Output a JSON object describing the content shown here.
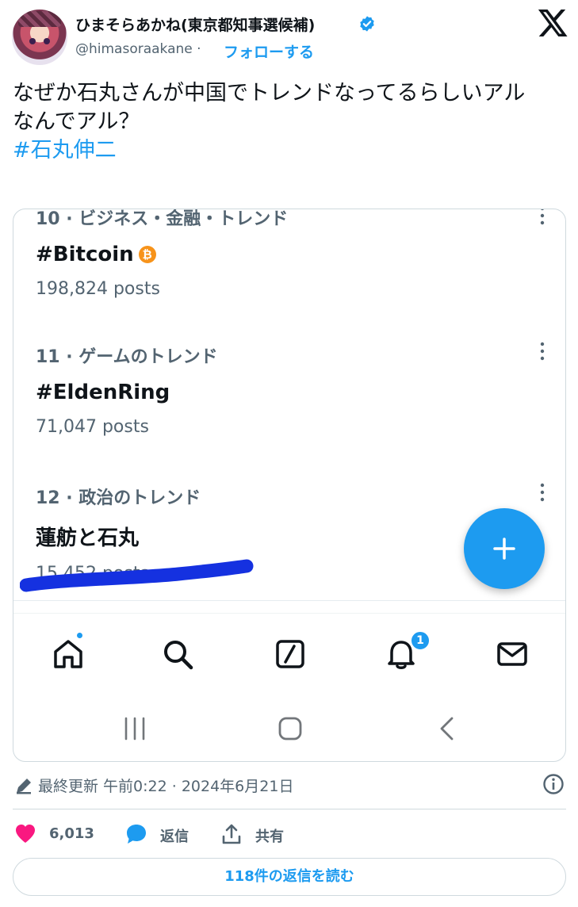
{
  "author": {
    "name": "ひまそらあかね(東京都知事選候補)",
    "handle": "@himasoraakane",
    "separator": "·",
    "follow_label": "フォローする"
  },
  "tweet": {
    "line1": "なぜか石丸さんが中国でトレンドなってるらしいアル",
    "line2": "なんでアル？",
    "hashtag": "#石丸伸二"
  },
  "screenshot": {
    "trends": [
      {
        "meta": "10 · ビジネス・金融・トレンド",
        "name": "#Bitcoin",
        "count": "198,824 posts"
      },
      {
        "meta": "11 · ゲームのトレンド",
        "name": "#EldenRing",
        "count": "71,047 posts"
      },
      {
        "meta": "12 · 政治のトレンド",
        "name": "蓮舫と石丸",
        "count": "15,452 posts"
      }
    ],
    "bitcoin_glyph": "₿",
    "notification_count": "1",
    "fab_icon": "plus-icon",
    "tab_icons": [
      "home-icon",
      "search-icon",
      "grok-icon",
      "bell-icon",
      "mail-icon"
    ],
    "scribble_color": "#1531e0"
  },
  "meta": {
    "timestamp": "最終更新 午前0:22 · 2024年6月21日"
  },
  "actions": {
    "likes": "6,013",
    "reply_label": "返信",
    "share_label": "共有"
  },
  "read_replies_label": "118件の返信を読む",
  "colors": {
    "accent": "#1d9bf0",
    "like": "#f91880",
    "text": "#0f1419",
    "muted": "#536471"
  }
}
